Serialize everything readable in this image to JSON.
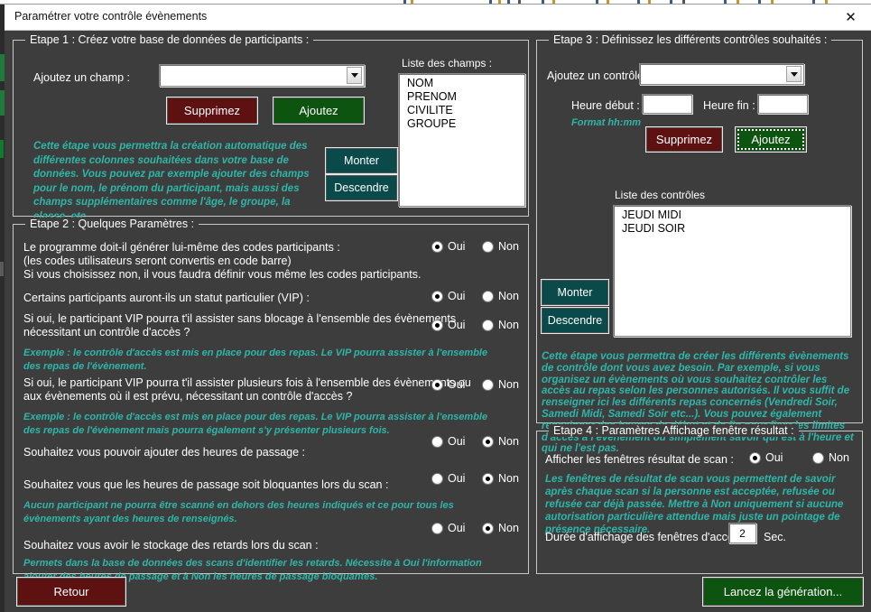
{
  "window": {
    "title": "Paramétrer votre contrôle évènements",
    "close_icon": "close-icon"
  },
  "step1": {
    "legend": "Etape 1 : Créez votre base de données de participants :",
    "field_label": "Ajoutez un champ :",
    "combo_value": "",
    "delete_button": "Supprimez",
    "add_button": "Ajoutez",
    "list_title": "Liste des champs :",
    "fields": [
      "NOM",
      "PRENOM",
      "CIVILITE",
      "GROUPE"
    ],
    "up_button": "Monter",
    "down_button": "Descendre",
    "hint": "Cette étape vous permettra la création automatique des différentes colonnes souhaitées dans votre base de données. Vous pouvez par exemple ajouter des champs pour le nom, le prénom du participant, mais aussi des champs supplémentaires comme l'âge, le groupe, la classe, etc..."
  },
  "step2": {
    "legend": "Etape 2 : Quelques Paramètres :",
    "yes_label": "Oui",
    "no_label": "Non",
    "questions": [
      {
        "lines": [
          "Le programme doit-il générer lui-même des codes participants :",
          "(les codes utilisateurs seront convertis en code barre)",
          "Si vous choisissez non, il vous faudra définir vous même les codes participants."
        ],
        "selected": "Oui"
      },
      {
        "lines": [
          "Certains participants auront-ils un statut particulier (VIP) :"
        ],
        "selected": "Oui"
      },
      {
        "lines": [
          "Si oui, le participant VIP pourra t'il assister sans blocage à l'ensemble des évènements",
          "nécessitant un contrôle d'accès ?"
        ],
        "selected": "Oui"
      },
      {
        "lines": [
          "Si oui, le participant VIP pourra t'il assister plusieurs fois à l'ensemble des évènements ou",
          "aux évènements où il est prévu, nécessitant un contrôle d'accès ?"
        ],
        "selected": "Oui"
      },
      {
        "lines": [
          "Souhaitez vous pouvoir ajouter des heures de passage :"
        ],
        "selected": "Non"
      },
      {
        "lines": [
          "Souhaitez vous que les heures de passage soit bloquantes lors du scan :"
        ],
        "selected": "Non"
      },
      {
        "lines": [
          "Souhaitez vous avoir le stockage des retards lors du scan :"
        ],
        "selected": "Non"
      }
    ],
    "hints": [
      "Exemple : le contrôle d'accès est mis en place pour des repas. Le VIP pourra assister à l'ensemble des repas de l'évènement.",
      "Exemple : le contrôle d'accès est mis en place pour des repas. Le VIP pourra assister à l'ensemble des repas de l'évènement mais pourra également s'y présenter plusieurs fois.",
      "Aucun participant ne pourra être scanné en dehors des heures indiqués et ce pour tous les évènements ayant des heures de renseignés.",
      "Permets dans la base de données des scans d'identifier les retards. Nécessite à Oui l'information ajouter des heures de passage et à Non les heures de passage bloquantes."
    ]
  },
  "step3": {
    "legend": "Etape 3 : Définissez les différents contrôles souhaités :",
    "control_label": "Ajoutez un contrôle :",
    "control_combo_value": "",
    "start_label": "Heure début :",
    "start_value": "",
    "end_label": "Heure fin :",
    "end_value": "",
    "format_hint": "Format hh:mm",
    "delete_button": "Supprimez",
    "add_button": "Ajoutez",
    "list_title": "Liste des contrôles",
    "controls": [
      "JEUDI MIDI",
      "JEUDI SOIR"
    ],
    "up_button": "Monter",
    "down_button": "Descendre",
    "hint": "Cette étape vous permettra de créer les différents évènements de contrôle dont vous avez besoin. Par exemple, si vous organisez un évènements où vous souhaitez contrôler les accès au repas selon les personnes autorisés. Il vous suffit de renseigner ici les différents repas concernés (Vendredi Soir, Samedi Midi, Samedi Soir etc...). Vous pouvez également renseigner des heures de début et de fin pour fixer les limites d'accès à l'événement ou simplement savoir qui est à l'heure et qui ne l'est pas."
  },
  "step4": {
    "legend": "Etape 4 : Paramètres Affichage fenêtre résultat :",
    "display_label": "Afficher les fenêtres résultat de scan :",
    "yes_label": "Oui",
    "no_label": "Non",
    "display_selected": "Oui",
    "hint": "Les fenêtres de résultat de scan vous permettent de savoir après chaque scan si la personne est acceptée, refusée ou refusée car déjà passée. Mettre à Non uniquement si aucune autorisation particulière attendue mais juste un pointage de présence nécessaire.",
    "duration_label": "Durée d'affichage des fenêtres d'accès :",
    "duration_value": "2",
    "duration_unit": "Sec."
  },
  "footer": {
    "back_button": "Retour",
    "generate_button": "Lancez la génération..."
  },
  "colors": {
    "background": "#3d3d3d",
    "accent_teal": "#2fb6a8",
    "button_red": "#5e1111",
    "button_green": "#0d5410",
    "button_teal": "#0b4a4a",
    "text": "#ffffff"
  }
}
